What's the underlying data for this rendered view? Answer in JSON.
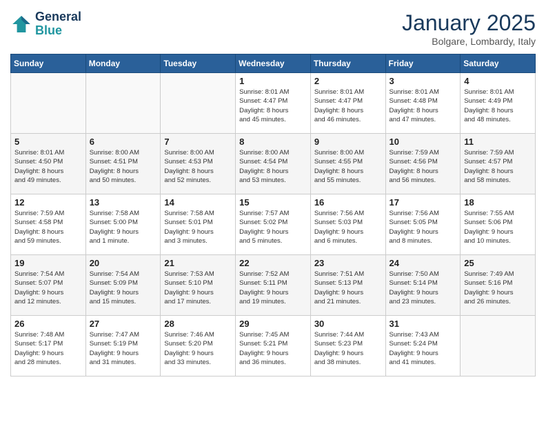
{
  "logo": {
    "line1": "General",
    "line2": "Blue"
  },
  "title": "January 2025",
  "subtitle": "Bolgare, Lombardy, Italy",
  "days_of_week": [
    "Sunday",
    "Monday",
    "Tuesday",
    "Wednesday",
    "Thursday",
    "Friday",
    "Saturday"
  ],
  "weeks": [
    [
      {
        "day": "",
        "info": ""
      },
      {
        "day": "",
        "info": ""
      },
      {
        "day": "",
        "info": ""
      },
      {
        "day": "1",
        "info": "Sunrise: 8:01 AM\nSunset: 4:47 PM\nDaylight: 8 hours\nand 45 minutes."
      },
      {
        "day": "2",
        "info": "Sunrise: 8:01 AM\nSunset: 4:47 PM\nDaylight: 8 hours\nand 46 minutes."
      },
      {
        "day": "3",
        "info": "Sunrise: 8:01 AM\nSunset: 4:48 PM\nDaylight: 8 hours\nand 47 minutes."
      },
      {
        "day": "4",
        "info": "Sunrise: 8:01 AM\nSunset: 4:49 PM\nDaylight: 8 hours\nand 48 minutes."
      }
    ],
    [
      {
        "day": "5",
        "info": "Sunrise: 8:01 AM\nSunset: 4:50 PM\nDaylight: 8 hours\nand 49 minutes."
      },
      {
        "day": "6",
        "info": "Sunrise: 8:00 AM\nSunset: 4:51 PM\nDaylight: 8 hours\nand 50 minutes."
      },
      {
        "day": "7",
        "info": "Sunrise: 8:00 AM\nSunset: 4:53 PM\nDaylight: 8 hours\nand 52 minutes."
      },
      {
        "day": "8",
        "info": "Sunrise: 8:00 AM\nSunset: 4:54 PM\nDaylight: 8 hours\nand 53 minutes."
      },
      {
        "day": "9",
        "info": "Sunrise: 8:00 AM\nSunset: 4:55 PM\nDaylight: 8 hours\nand 55 minutes."
      },
      {
        "day": "10",
        "info": "Sunrise: 7:59 AM\nSunset: 4:56 PM\nDaylight: 8 hours\nand 56 minutes."
      },
      {
        "day": "11",
        "info": "Sunrise: 7:59 AM\nSunset: 4:57 PM\nDaylight: 8 hours\nand 58 minutes."
      }
    ],
    [
      {
        "day": "12",
        "info": "Sunrise: 7:59 AM\nSunset: 4:58 PM\nDaylight: 8 hours\nand 59 minutes."
      },
      {
        "day": "13",
        "info": "Sunrise: 7:58 AM\nSunset: 5:00 PM\nDaylight: 9 hours\nand 1 minute."
      },
      {
        "day": "14",
        "info": "Sunrise: 7:58 AM\nSunset: 5:01 PM\nDaylight: 9 hours\nand 3 minutes."
      },
      {
        "day": "15",
        "info": "Sunrise: 7:57 AM\nSunset: 5:02 PM\nDaylight: 9 hours\nand 5 minutes."
      },
      {
        "day": "16",
        "info": "Sunrise: 7:56 AM\nSunset: 5:03 PM\nDaylight: 9 hours\nand 6 minutes."
      },
      {
        "day": "17",
        "info": "Sunrise: 7:56 AM\nSunset: 5:05 PM\nDaylight: 9 hours\nand 8 minutes."
      },
      {
        "day": "18",
        "info": "Sunrise: 7:55 AM\nSunset: 5:06 PM\nDaylight: 9 hours\nand 10 minutes."
      }
    ],
    [
      {
        "day": "19",
        "info": "Sunrise: 7:54 AM\nSunset: 5:07 PM\nDaylight: 9 hours\nand 12 minutes."
      },
      {
        "day": "20",
        "info": "Sunrise: 7:54 AM\nSunset: 5:09 PM\nDaylight: 9 hours\nand 15 minutes."
      },
      {
        "day": "21",
        "info": "Sunrise: 7:53 AM\nSunset: 5:10 PM\nDaylight: 9 hours\nand 17 minutes."
      },
      {
        "day": "22",
        "info": "Sunrise: 7:52 AM\nSunset: 5:11 PM\nDaylight: 9 hours\nand 19 minutes."
      },
      {
        "day": "23",
        "info": "Sunrise: 7:51 AM\nSunset: 5:13 PM\nDaylight: 9 hours\nand 21 minutes."
      },
      {
        "day": "24",
        "info": "Sunrise: 7:50 AM\nSunset: 5:14 PM\nDaylight: 9 hours\nand 23 minutes."
      },
      {
        "day": "25",
        "info": "Sunrise: 7:49 AM\nSunset: 5:16 PM\nDaylight: 9 hours\nand 26 minutes."
      }
    ],
    [
      {
        "day": "26",
        "info": "Sunrise: 7:48 AM\nSunset: 5:17 PM\nDaylight: 9 hours\nand 28 minutes."
      },
      {
        "day": "27",
        "info": "Sunrise: 7:47 AM\nSunset: 5:19 PM\nDaylight: 9 hours\nand 31 minutes."
      },
      {
        "day": "28",
        "info": "Sunrise: 7:46 AM\nSunset: 5:20 PM\nDaylight: 9 hours\nand 33 minutes."
      },
      {
        "day": "29",
        "info": "Sunrise: 7:45 AM\nSunset: 5:21 PM\nDaylight: 9 hours\nand 36 minutes."
      },
      {
        "day": "30",
        "info": "Sunrise: 7:44 AM\nSunset: 5:23 PM\nDaylight: 9 hours\nand 38 minutes."
      },
      {
        "day": "31",
        "info": "Sunrise: 7:43 AM\nSunset: 5:24 PM\nDaylight: 9 hours\nand 41 minutes."
      },
      {
        "day": "",
        "info": ""
      }
    ]
  ]
}
